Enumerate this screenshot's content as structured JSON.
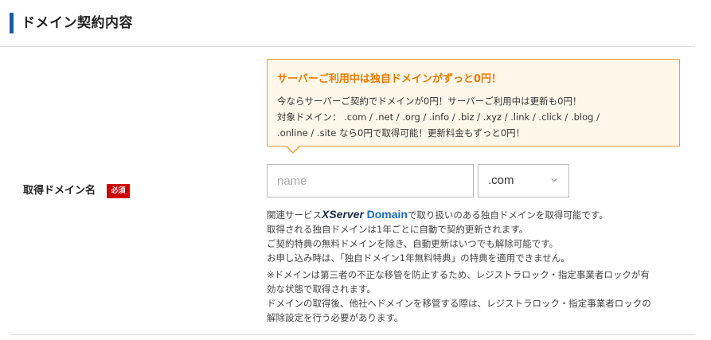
{
  "section": {
    "title": "ドメイン契約内容"
  },
  "domain_field": {
    "label": "取得ドメイン名",
    "required_badge": "必須",
    "input_placeholder": "name",
    "tld_selected": ".com"
  },
  "promo": {
    "title": "サーバーご利用中は独自ドメインがずっと0円！",
    "lines": [
      "今ならサーバーご契約でドメインが0円！サーバーご利用中は更新も0円！",
      "対象ドメイン： .com / .net / .org / .info / .biz / .xyz / .link / .click / .blog /",
      ".online / .site なら0円で取得可能！更新料金もずっと0円！"
    ]
  },
  "description": {
    "prefix": "関連サービス",
    "brand_x": "XServer",
    "brand_domain": "Domain",
    "suffix": "で取り扱いのある独自ドメインを取得可能です。",
    "lines": [
      "取得される独自ドメインは1年ごとに自動で契約更新されます。",
      "ご契約特典の無料ドメインを除き、自動更新はいつでも解除可能です。",
      "お申し込み時は、「独自ドメイン1年無料特典」の特典を適用できません。"
    ]
  },
  "notes": [
    "※ドメインは第三者の不正な移管を防止するため、レジストラロック・指定事業者ロックが有",
    "効な状態で取得されます。",
    "ドメインの取得後、他社へドメインを移管する際は、レジストラロック・指定事業者ロックの",
    "解除設定を行う必要があります。"
  ],
  "colors": {
    "accent": "#1a5ca8",
    "promo_title": "#f07a00",
    "promo_border": "#f0a03a",
    "required": "#d10000"
  }
}
